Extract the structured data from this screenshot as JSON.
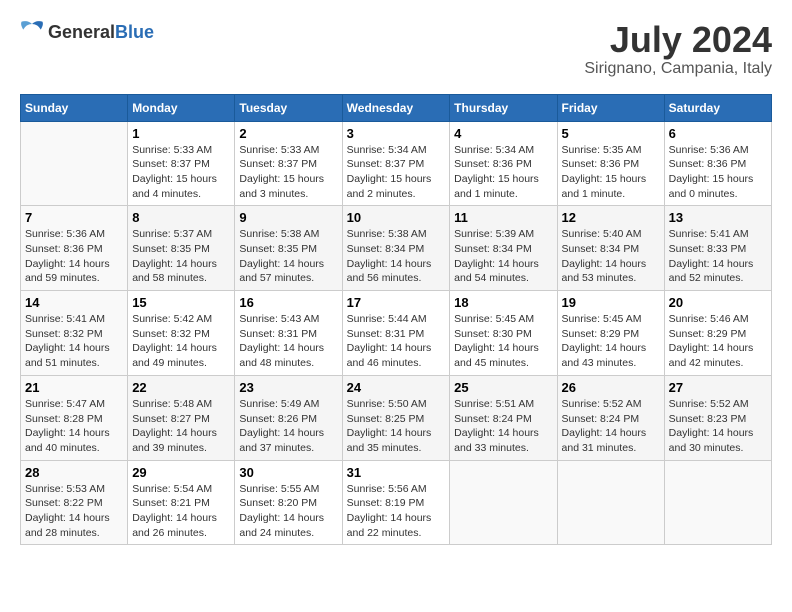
{
  "logo": {
    "text_general": "General",
    "text_blue": "Blue"
  },
  "header": {
    "month_year": "July 2024",
    "location": "Sirignano, Campania, Italy"
  },
  "weekdays": [
    "Sunday",
    "Monday",
    "Tuesday",
    "Wednesday",
    "Thursday",
    "Friday",
    "Saturday"
  ],
  "weeks": [
    [
      {
        "day": "",
        "sunrise": "",
        "sunset": "",
        "daylight": ""
      },
      {
        "day": "1",
        "sunrise": "Sunrise: 5:33 AM",
        "sunset": "Sunset: 8:37 PM",
        "daylight": "Daylight: 15 hours and 4 minutes."
      },
      {
        "day": "2",
        "sunrise": "Sunrise: 5:33 AM",
        "sunset": "Sunset: 8:37 PM",
        "daylight": "Daylight: 15 hours and 3 minutes."
      },
      {
        "day": "3",
        "sunrise": "Sunrise: 5:34 AM",
        "sunset": "Sunset: 8:37 PM",
        "daylight": "Daylight: 15 hours and 2 minutes."
      },
      {
        "day": "4",
        "sunrise": "Sunrise: 5:34 AM",
        "sunset": "Sunset: 8:36 PM",
        "daylight": "Daylight: 15 hours and 1 minute."
      },
      {
        "day": "5",
        "sunrise": "Sunrise: 5:35 AM",
        "sunset": "Sunset: 8:36 PM",
        "daylight": "Daylight: 15 hours and 1 minute."
      },
      {
        "day": "6",
        "sunrise": "Sunrise: 5:36 AM",
        "sunset": "Sunset: 8:36 PM",
        "daylight": "Daylight: 15 hours and 0 minutes."
      }
    ],
    [
      {
        "day": "7",
        "sunrise": "Sunrise: 5:36 AM",
        "sunset": "Sunset: 8:36 PM",
        "daylight": "Daylight: 14 hours and 59 minutes."
      },
      {
        "day": "8",
        "sunrise": "Sunrise: 5:37 AM",
        "sunset": "Sunset: 8:35 PM",
        "daylight": "Daylight: 14 hours and 58 minutes."
      },
      {
        "day": "9",
        "sunrise": "Sunrise: 5:38 AM",
        "sunset": "Sunset: 8:35 PM",
        "daylight": "Daylight: 14 hours and 57 minutes."
      },
      {
        "day": "10",
        "sunrise": "Sunrise: 5:38 AM",
        "sunset": "Sunset: 8:34 PM",
        "daylight": "Daylight: 14 hours and 56 minutes."
      },
      {
        "day": "11",
        "sunrise": "Sunrise: 5:39 AM",
        "sunset": "Sunset: 8:34 PM",
        "daylight": "Daylight: 14 hours and 54 minutes."
      },
      {
        "day": "12",
        "sunrise": "Sunrise: 5:40 AM",
        "sunset": "Sunset: 8:34 PM",
        "daylight": "Daylight: 14 hours and 53 minutes."
      },
      {
        "day": "13",
        "sunrise": "Sunrise: 5:41 AM",
        "sunset": "Sunset: 8:33 PM",
        "daylight": "Daylight: 14 hours and 52 minutes."
      }
    ],
    [
      {
        "day": "14",
        "sunrise": "Sunrise: 5:41 AM",
        "sunset": "Sunset: 8:32 PM",
        "daylight": "Daylight: 14 hours and 51 minutes."
      },
      {
        "day": "15",
        "sunrise": "Sunrise: 5:42 AM",
        "sunset": "Sunset: 8:32 PM",
        "daylight": "Daylight: 14 hours and 49 minutes."
      },
      {
        "day": "16",
        "sunrise": "Sunrise: 5:43 AM",
        "sunset": "Sunset: 8:31 PM",
        "daylight": "Daylight: 14 hours and 48 minutes."
      },
      {
        "day": "17",
        "sunrise": "Sunrise: 5:44 AM",
        "sunset": "Sunset: 8:31 PM",
        "daylight": "Daylight: 14 hours and 46 minutes."
      },
      {
        "day": "18",
        "sunrise": "Sunrise: 5:45 AM",
        "sunset": "Sunset: 8:30 PM",
        "daylight": "Daylight: 14 hours and 45 minutes."
      },
      {
        "day": "19",
        "sunrise": "Sunrise: 5:45 AM",
        "sunset": "Sunset: 8:29 PM",
        "daylight": "Daylight: 14 hours and 43 minutes."
      },
      {
        "day": "20",
        "sunrise": "Sunrise: 5:46 AM",
        "sunset": "Sunset: 8:29 PM",
        "daylight": "Daylight: 14 hours and 42 minutes."
      }
    ],
    [
      {
        "day": "21",
        "sunrise": "Sunrise: 5:47 AM",
        "sunset": "Sunset: 8:28 PM",
        "daylight": "Daylight: 14 hours and 40 minutes."
      },
      {
        "day": "22",
        "sunrise": "Sunrise: 5:48 AM",
        "sunset": "Sunset: 8:27 PM",
        "daylight": "Daylight: 14 hours and 39 minutes."
      },
      {
        "day": "23",
        "sunrise": "Sunrise: 5:49 AM",
        "sunset": "Sunset: 8:26 PM",
        "daylight": "Daylight: 14 hours and 37 minutes."
      },
      {
        "day": "24",
        "sunrise": "Sunrise: 5:50 AM",
        "sunset": "Sunset: 8:25 PM",
        "daylight": "Daylight: 14 hours and 35 minutes."
      },
      {
        "day": "25",
        "sunrise": "Sunrise: 5:51 AM",
        "sunset": "Sunset: 8:24 PM",
        "daylight": "Daylight: 14 hours and 33 minutes."
      },
      {
        "day": "26",
        "sunrise": "Sunrise: 5:52 AM",
        "sunset": "Sunset: 8:24 PM",
        "daylight": "Daylight: 14 hours and 31 minutes."
      },
      {
        "day": "27",
        "sunrise": "Sunrise: 5:52 AM",
        "sunset": "Sunset: 8:23 PM",
        "daylight": "Daylight: 14 hours and 30 minutes."
      }
    ],
    [
      {
        "day": "28",
        "sunrise": "Sunrise: 5:53 AM",
        "sunset": "Sunset: 8:22 PM",
        "daylight": "Daylight: 14 hours and 28 minutes."
      },
      {
        "day": "29",
        "sunrise": "Sunrise: 5:54 AM",
        "sunset": "Sunset: 8:21 PM",
        "daylight": "Daylight: 14 hours and 26 minutes."
      },
      {
        "day": "30",
        "sunrise": "Sunrise: 5:55 AM",
        "sunset": "Sunset: 8:20 PM",
        "daylight": "Daylight: 14 hours and 24 minutes."
      },
      {
        "day": "31",
        "sunrise": "Sunrise: 5:56 AM",
        "sunset": "Sunset: 8:19 PM",
        "daylight": "Daylight: 14 hours and 22 minutes."
      },
      {
        "day": "",
        "sunrise": "",
        "sunset": "",
        "daylight": ""
      },
      {
        "day": "",
        "sunrise": "",
        "sunset": "",
        "daylight": ""
      },
      {
        "day": "",
        "sunrise": "",
        "sunset": "",
        "daylight": ""
      }
    ]
  ]
}
